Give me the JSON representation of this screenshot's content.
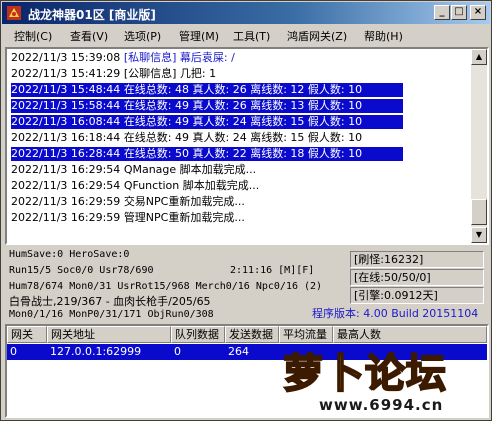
{
  "window": {
    "title": "战龙神器01区 [商业版]",
    "controls": {
      "minimize": "_",
      "maximize": "□",
      "close": "×"
    }
  },
  "menu": [
    "控制(C)",
    "查看(V)",
    "选项(P)",
    "管理(M)",
    "工具(T)",
    "鸿盾网关(Z)",
    "帮助(H)"
  ],
  "log": [
    {
      "time": "2022/11/3 15:39:08",
      "text": "[私聊信息] 幕后袁屎: /",
      "selected": false
    },
    {
      "time": "2022/11/3 15:41:29",
      "text": "[公聊信息] 几把: 1",
      "selected": false
    },
    {
      "time": "2022/11/3 15:48:44",
      "text": "在线总数: 48 真人数: 26 离线数: 12 假人数: 10",
      "selected": true
    },
    {
      "time": "2022/11/3 15:58:44",
      "text": "在线总数: 49 真人数: 26 离线数: 13 假人数: 10",
      "selected": true
    },
    {
      "time": "2022/11/3 16:08:44",
      "text": "在线总数: 49 真人数: 24 离线数: 15 假人数: 10",
      "selected": true
    },
    {
      "time": "2022/11/3 16:18:44",
      "text": "在线总数: 49 真人数: 24 离线数: 15 假人数: 10",
      "selected": false
    },
    {
      "time": "2022/11/3 16:28:44",
      "text": "在线总数: 50 真人数: 22 离线数: 18 假人数: 10",
      "selected": true
    },
    {
      "time": "2022/11/3 16:29:54",
      "text": "QManage 脚本加载完成...",
      "selected": false
    },
    {
      "time": "2022/11/3 16:29:54",
      "text": "QFunction 脚本加载完成...",
      "selected": false
    },
    {
      "time": "2022/11/3 16:29:59",
      "text": "交易NPC重新加载完成...",
      "selected": false
    },
    {
      "time": "2022/11/3 16:29:59",
      "text": "管理NPC重新加载完成...",
      "selected": false
    }
  ],
  "status": {
    "line1": "HumSave:0 HeroSave:0",
    "line2": "Run15/5 Soc0/0 Usr78/690",
    "uptime": "2:11:16 [M][F]",
    "line3": "Hum78/674 Mon0/31 UsrRot15/968 Merch0/16 Npc0/16 (2)",
    "line4": "白骨战士,219/367 - 血肉长枪手/205/65",
    "line5": "Mon0/1/16 MonP0/31/171 ObjRun0/308",
    "refresh": "[刷怪:16232]",
    "online": "[在线:50/50/0]",
    "interval": "[引擎:0.0912天]",
    "version": "程序版本: 4.00 Build 20151104"
  },
  "grid": {
    "headers": [
      "网关",
      "网关地址",
      "队列数据",
      "发送数据",
      "平均流量",
      "最高人数"
    ],
    "rows": [
      [
        "0",
        "127.0.0.1:62999",
        "0",
        "264",
        "",
        ""
      ]
    ]
  },
  "watermark": {
    "logo": "萝卜论坛",
    "url": "www.6994.cn"
  }
}
